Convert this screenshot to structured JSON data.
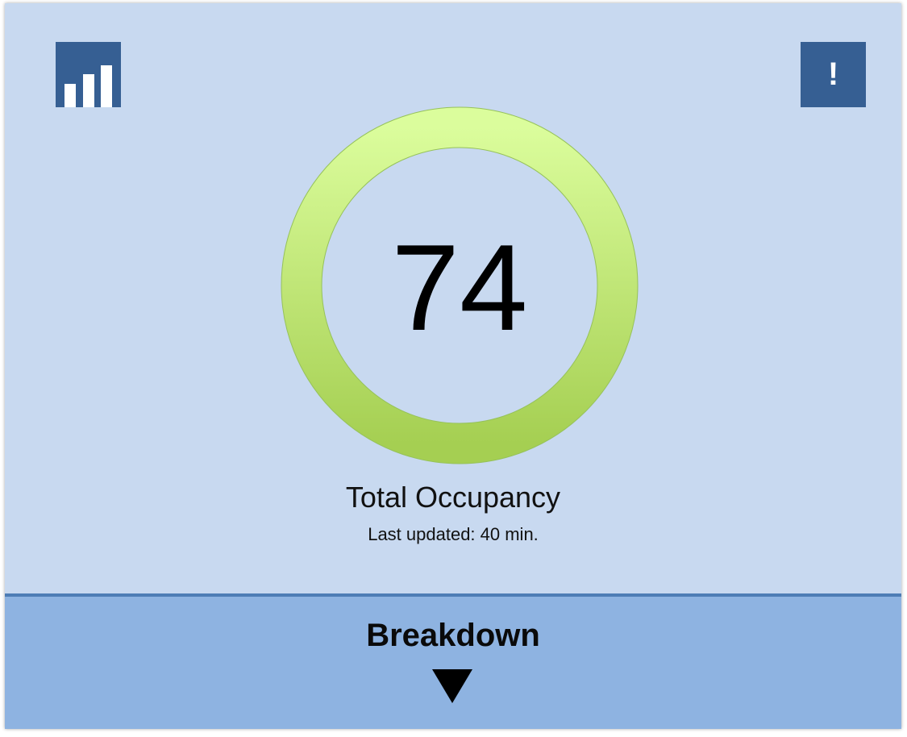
{
  "toolbar": {
    "stats_icon": "bar-chart-icon",
    "alert_icon": "alert-icon",
    "alert_glyph": "!"
  },
  "occupancy": {
    "value": "74",
    "title": "Total Occupancy",
    "last_updated": "Last updated: 40 min."
  },
  "breakdown": {
    "label": "Breakdown",
    "arrow_icon": "triangle-down-icon"
  },
  "colors": {
    "background": "#c8d9f0",
    "button": "#365f93",
    "ring_top": "#dbfd9c",
    "ring_bottom": "#a5cf52",
    "drawer": "#8eb3e1"
  }
}
